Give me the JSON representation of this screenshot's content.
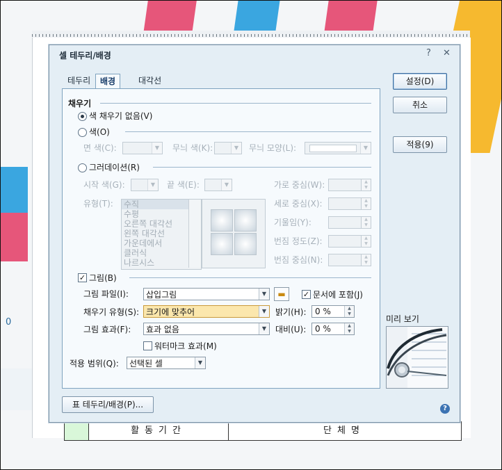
{
  "dialog": {
    "title": "셀 테두리/배경",
    "help_glyph": "?",
    "close_glyph": "✕",
    "tabs": [
      "테두리",
      "배경",
      "대각선"
    ],
    "active_tab": "배경"
  },
  "buttons": {
    "set": "설정(D)",
    "cancel": "취소",
    "apply": "적용(9)",
    "border_bg": "표 테두리/배경(P)..."
  },
  "fill": {
    "section": "채우기",
    "no_fill": "색 채우기 없음(V)",
    "color": "색(O)",
    "face_color": "면 색(C):",
    "pattern_color": "무늬 색(K):",
    "pattern_shape": "무늬 모양(L):",
    "gradation": "그러데이션(R)",
    "start_color": "시작 색(G):",
    "end_color": "끝 색(E):",
    "type": "유형(T):",
    "type_options": [
      "수직",
      "수평",
      "오른쪽 대각선",
      "왼쪽 대각선",
      "가운데에서",
      "클러식",
      "나르시스"
    ],
    "horizontal_center": "가로 중심(W):",
    "vertical_center": "세로 중심(X):",
    "tilt": "기울임(Y):",
    "blur_level": "번짐 정도(Z):",
    "blur_center": "번짐 중심(N):"
  },
  "picture": {
    "checkbox": "그림(B)",
    "file_label": "그림 파일(I):",
    "file_value": "삽입그림",
    "embed": "문서에 포함(J)",
    "fill_type_label": "채우기 유형(S):",
    "fill_type_value": "크기에 맞추어",
    "brightness_label": "밝기(H):",
    "brightness_value": "0 %",
    "effect_label": "그림 효과(F):",
    "effect_value": "효과 없음",
    "contrast_label": "대비(U):",
    "contrast_value": "0 %",
    "watermark": "워터마크 효과(M)"
  },
  "scope": {
    "label": "적용 범위(Q):",
    "value": "선택된 셀"
  },
  "preview": {
    "label": "미리 보기"
  },
  "document": {
    "col1": "활동기간",
    "col2": "단체명",
    "side_digit": "0"
  }
}
